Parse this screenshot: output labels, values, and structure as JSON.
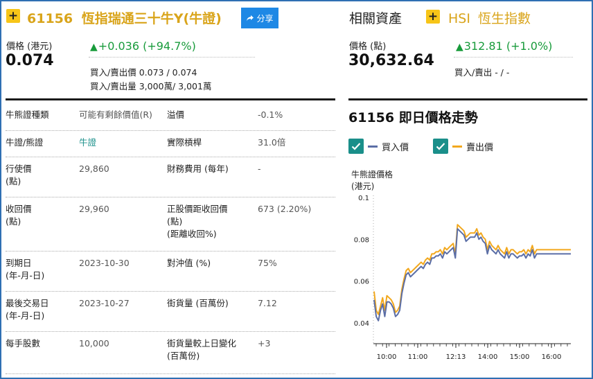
{
  "header": {
    "plus_icon": "+",
    "code": "61156",
    "name": "恆指瑞通三十牛Y",
    "type_tag": "(牛證)",
    "share_label": "分享"
  },
  "quote": {
    "price_label": "價格 (港元)",
    "price": "0.074",
    "change": "+0.036",
    "change_pct": "(+94.7%)",
    "bid_ask_price_label": "買入/賣出價",
    "bid_ask_price": "0.073 / 0.074",
    "bid_ask_vol_label": "買入/賣出量",
    "bid_ask_vol": "3,000萬/ 3,001萬"
  },
  "related": {
    "title": "相關資產",
    "plus_icon": "+",
    "code": "HSI",
    "name": "恆生指數",
    "price_label": "價格 (點)",
    "price": "30,632.64",
    "change": "312.81",
    "change_pct": "(+1.0%)",
    "bid_ask_label": "買入/賣出",
    "bid_ask": "- / -"
  },
  "details": {
    "rows": [
      {
        "k1": "牛熊證種類",
        "v1": "可能有剩餘價值(R)",
        "k2": "溢價",
        "v2": "-0.1%"
      },
      {
        "k1": "牛證/熊證",
        "v1": "牛證",
        "k2": "實際槓桿",
        "v2": "31.0倍"
      },
      {
        "k1": "行使價\n(點)",
        "v1": "29,860",
        "k2": "財務費用 (每年)",
        "v2": "-"
      },
      {
        "k1": "收回價\n(點)",
        "v1": "29,960",
        "k2": "正股價距收回價\n(點)\n(距離收回%)",
        "v2": "673 (2.20%)"
      },
      {
        "k1": "到期日\n(年-月-日)",
        "v1": "2023-10-30",
        "k2": "對沖值 (%)",
        "v2": "75%"
      },
      {
        "k1": "最後交易日\n(年-月-日)",
        "v1": "2023-10-27",
        "k2": "街貨量 (百萬份)",
        "v2": "7.12"
      },
      {
        "k1": "每手股數",
        "v1": "10,000",
        "k2": "街貨量較上日變化\n(百萬份)",
        "v2": "+3"
      }
    ]
  },
  "chart_section": {
    "title": "61156 即日價格走勢",
    "legend_bid": "買入價",
    "legend_ask": "賣出價",
    "ylabel_line1": "牛熊證價格",
    "ylabel_line2": "(港元)"
  },
  "colors": {
    "bid_line": "#5b6ea6",
    "ask_line": "#f2a81d",
    "accent_yellow": "#f7c518",
    "title_gold": "#d9a41a",
    "up_green": "#189b3b",
    "teal": "#1a8f8a",
    "share_blue": "#1e88e5"
  },
  "chart_data": {
    "type": "line",
    "xlabel": "",
    "ylabel": "牛熊證價格 (港元)",
    "ylim": [
      0.03,
      0.1
    ],
    "yticks": [
      0.04,
      0.06,
      0.08,
      0.1
    ],
    "xlim": [
      9.67,
      16.67
    ],
    "xticks": [
      {
        "value": 10,
        "label": "10:00"
      },
      {
        "value": 11,
        "label": "11:00"
      },
      {
        "value": 12.22,
        "label": "12:13"
      },
      {
        "value": 13,
        "label": "14:00"
      },
      {
        "value": 14,
        "label": "15:00"
      },
      {
        "value": 15,
        "label": "16:00"
      }
    ],
    "grid": false,
    "series": [
      {
        "name": "買入價",
        "x": [
          9.67,
          9.72,
          9.77,
          9.83,
          9.88,
          9.93,
          9.98,
          10.03,
          10.1,
          10.17,
          10.23,
          10.3,
          10.37,
          10.43,
          10.5,
          10.57,
          10.63,
          10.7,
          10.77,
          10.83,
          10.9,
          10.97,
          11.03,
          11.1,
          11.17,
          11.23,
          11.3,
          11.37,
          11.43,
          11.5,
          11.57,
          11.63,
          11.7,
          11.77,
          11.83,
          11.9,
          11.97,
          12.03,
          12.1,
          12.17,
          12.2,
          12.22,
          12.3,
          12.37,
          12.43,
          12.5,
          12.57,
          12.63,
          12.7,
          12.77,
          12.83,
          12.9,
          12.97,
          13.03,
          13.1,
          13.17,
          13.23,
          13.3,
          13.37,
          13.43,
          13.5,
          13.57,
          13.63,
          13.7,
          13.77,
          13.83,
          13.9,
          13.97,
          14.03,
          14.1,
          14.17,
          14.23,
          14.3,
          14.37,
          14.43,
          14.5,
          14.57,
          14.63,
          14.7,
          14.77,
          14.83,
          14.9,
          14.97,
          15.03,
          15.1,
          15.17,
          15.23,
          15.3,
          15.37,
          15.43,
          15.5,
          15.57,
          15.63
        ],
        "values": [
          0.051,
          0.043,
          0.041,
          0.046,
          0.049,
          0.043,
          0.05,
          0.05,
          0.049,
          0.047,
          0.043,
          0.044,
          0.046,
          0.054,
          0.059,
          0.063,
          0.064,
          0.062,
          0.063,
          0.064,
          0.065,
          0.066,
          0.067,
          0.066,
          0.068,
          0.069,
          0.068,
          0.071,
          0.071,
          0.072,
          0.072,
          0.073,
          0.071,
          0.074,
          0.073,
          0.074,
          0.075,
          0.076,
          0.071,
          0.085,
          0.084,
          0.083,
          0.082,
          0.079,
          0.08,
          0.081,
          0.081,
          0.081,
          0.083,
          0.08,
          0.081,
          0.079,
          0.078,
          0.073,
          0.077,
          0.075,
          0.074,
          0.073,
          0.075,
          0.073,
          0.072,
          0.071,
          0.074,
          0.071,
          0.073,
          0.073,
          0.072,
          0.071,
          0.072,
          0.072,
          0.073,
          0.071,
          0.073,
          0.072,
          0.075,
          0.071,
          0.073,
          0.073,
          0.073,
          0.073,
          0.073,
          0.073,
          0.073,
          0.073,
          0.073,
          0.073,
          0.073,
          0.073,
          0.073,
          0.073,
          0.073,
          0.073,
          0.073
        ]
      },
      {
        "name": "賣出價",
        "x": [
          9.67,
          9.72,
          9.77,
          9.83,
          9.88,
          9.93,
          9.98,
          10.03,
          10.1,
          10.17,
          10.23,
          10.3,
          10.37,
          10.43,
          10.5,
          10.57,
          10.63,
          10.7,
          10.77,
          10.83,
          10.9,
          10.97,
          11.03,
          11.1,
          11.17,
          11.23,
          11.3,
          11.37,
          11.43,
          11.5,
          11.57,
          11.63,
          11.7,
          11.77,
          11.83,
          11.9,
          11.97,
          12.03,
          12.1,
          12.17,
          12.2,
          12.22,
          12.3,
          12.37,
          12.43,
          12.5,
          12.57,
          12.63,
          12.7,
          12.77,
          12.83,
          12.9,
          12.97,
          13.03,
          13.1,
          13.17,
          13.23,
          13.3,
          13.37,
          13.43,
          13.5,
          13.57,
          13.63,
          13.7,
          13.77,
          13.83,
          13.9,
          13.97,
          14.03,
          14.1,
          14.17,
          14.23,
          14.3,
          14.37,
          14.43,
          14.5,
          14.57,
          14.63,
          14.7,
          14.77,
          14.83,
          14.9,
          14.97,
          15.03,
          15.1,
          15.17,
          15.23,
          15.3,
          15.37,
          15.43,
          15.5,
          15.57,
          15.63
        ],
        "values": [
          0.055,
          0.046,
          0.044,
          0.048,
          0.052,
          0.046,
          0.053,
          0.052,
          0.051,
          0.049,
          0.045,
          0.046,
          0.048,
          0.056,
          0.061,
          0.065,
          0.066,
          0.064,
          0.065,
          0.066,
          0.067,
          0.068,
          0.069,
          0.068,
          0.07,
          0.071,
          0.07,
          0.073,
          0.073,
          0.074,
          0.074,
          0.075,
          0.073,
          0.076,
          0.075,
          0.076,
          0.077,
          0.078,
          0.073,
          0.087,
          0.086,
          0.085,
          0.084,
          0.081,
          0.082,
          0.083,
          0.083,
          0.083,
          0.085,
          0.082,
          0.083,
          0.081,
          0.08,
          0.075,
          0.079,
          0.077,
          0.076,
          0.075,
          0.077,
          0.075,
          0.074,
          0.073,
          0.076,
          0.073,
          0.075,
          0.075,
          0.074,
          0.073,
          0.074,
          0.074,
          0.075,
          0.073,
          0.075,
          0.074,
          0.077,
          0.073,
          0.075,
          0.075,
          0.075,
          0.075,
          0.075,
          0.075,
          0.075,
          0.075,
          0.075,
          0.075,
          0.075,
          0.075,
          0.075,
          0.075,
          0.075,
          0.075,
          0.075
        ]
      }
    ]
  }
}
